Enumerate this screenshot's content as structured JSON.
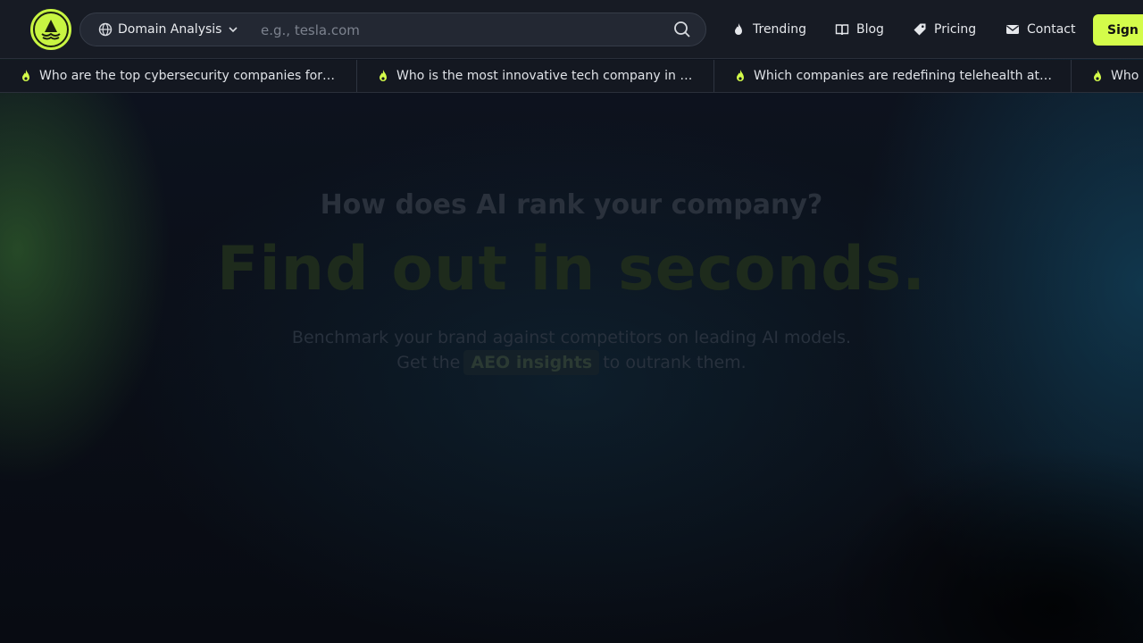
{
  "colors": {
    "accent": "#d4fc4a",
    "background": "#0b0f18",
    "nav_bg": "#171b24"
  },
  "nav": {
    "logo_icon": "sailboat-logo-icon",
    "search": {
      "mode_label": "Domain Analysis",
      "mode_icon": "globe-icon",
      "placeholder": "e.g., tesla.com",
      "value": ""
    },
    "links": [
      {
        "label": "Trending",
        "icon": "flame-icon"
      },
      {
        "label": "Blog",
        "icon": "book-icon"
      },
      {
        "label": "Pricing",
        "icon": "tag-icon"
      },
      {
        "label": "Contact",
        "icon": "envelope-icon"
      }
    ],
    "signin_label": "Sign In"
  },
  "ticker": {
    "items": [
      "Who are the top cybersecurity companies for…",
      "Who is the most innovative tech company in …",
      "Which companies are redefining telehealth at…",
      "Who"
    ]
  },
  "hero": {
    "question": "How does AI rank your company?",
    "headline": "Find out in seconds.",
    "subtitle_line1": "Benchmark your brand against competitors on leading AI models.",
    "subtitle_pre": "Get the",
    "subtitle_highlight": "AEO insights",
    "subtitle_post": "to outrank them."
  }
}
